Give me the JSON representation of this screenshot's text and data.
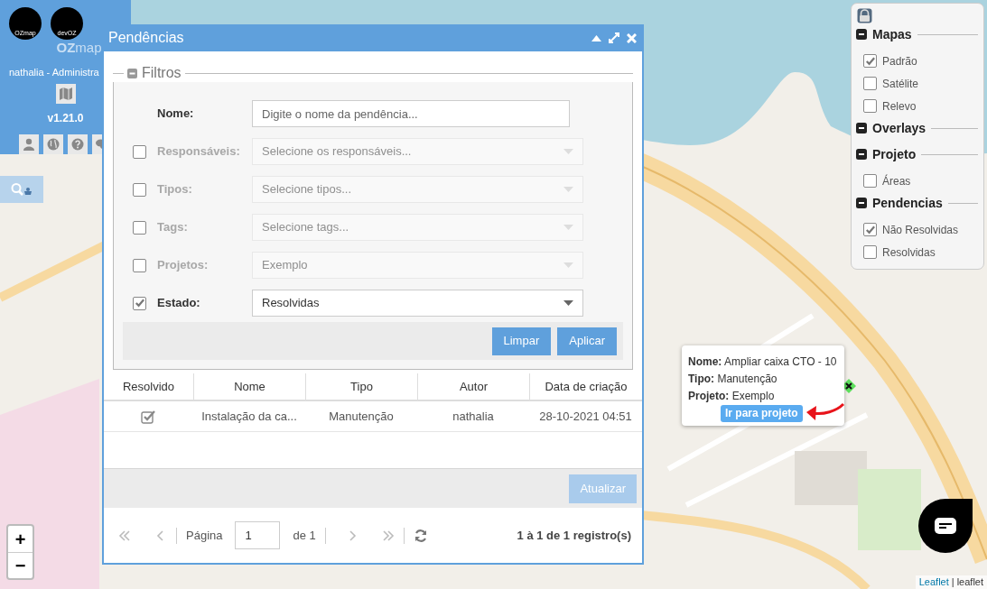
{
  "sidebar": {
    "logos": [
      "OZmap",
      "devOZ"
    ],
    "brand": "**OZ**map",
    "user": "nathalia - Administra",
    "version": "v1.21.0"
  },
  "dialog": {
    "title": "Pendências",
    "filters": {
      "legend": "Filtros",
      "expanded": true,
      "rows": [
        {
          "kind": "text",
          "label": "Nome:",
          "placeholder": "Digite o nome da pendência..."
        },
        {
          "kind": "select",
          "label": "Responsáveis:",
          "checked": false,
          "placeholder": "Selecione os responsáveis..."
        },
        {
          "kind": "select",
          "label": "Tipos:",
          "checked": false,
          "placeholder": "Selecione tipos..."
        },
        {
          "kind": "select",
          "label": "Tags:",
          "checked": false,
          "placeholder": "Selecione tags..."
        },
        {
          "kind": "select",
          "label": "Projetos:",
          "checked": false,
          "value": "Exemplo"
        },
        {
          "kind": "select",
          "label": "Estado:",
          "checked": true,
          "value": "Resolvidas"
        }
      ],
      "buttons": [
        "Limpar",
        "Aplicar"
      ]
    },
    "table": {
      "columns": [
        "Resolvido",
        "Nome",
        "Tipo",
        "Autor",
        "Data de criação"
      ],
      "rows": [
        {
          "resolved": true,
          "cells": [
            "",
            "Instalação da ca...",
            "Manutenção",
            "nathalia",
            "28-10-2021 04:51"
          ]
        }
      ]
    },
    "refresh_button": {
      "label": "Atualizar",
      "disabled": true
    },
    "pagination": {
      "page_label": "Página",
      "page": "1",
      "of": "de 1",
      "summary": "1 à 1 de 1 registro(s)"
    }
  },
  "layers": {
    "groups": [
      {
        "title": "Mapas",
        "expanded": true,
        "items": [
          {
            "label": "Padrão",
            "checked": true
          },
          {
            "label": "Satélite",
            "checked": false
          },
          {
            "label": "Relevo",
            "checked": false
          }
        ]
      },
      {
        "title": "Overlays",
        "expanded": true
      },
      {
        "title": "Projeto",
        "expanded": true,
        "items": [
          {
            "label": "Áreas",
            "checked": false
          }
        ]
      },
      {
        "title": "Pendencias",
        "expanded": true,
        "items": [
          {
            "label": "Não Resolvidas",
            "checked": true
          },
          {
            "label": "Resolvidas",
            "checked": false
          }
        ]
      }
    ]
  },
  "popup": {
    "fields": [
      {
        "label": "Nome:",
        "value": "Ampliar caixa CTO - 10"
      },
      {
        "label": "Tipo:",
        "value": "Manutenção"
      },
      {
        "label": "Projeto:",
        "value": "Exemplo"
      }
    ],
    "button": "Ir para projeto"
  },
  "zoom": [
    "+",
    "−"
  ],
  "attribution": {
    "link": "Leaflet",
    "separator": "|",
    "text": "leaflet"
  }
}
